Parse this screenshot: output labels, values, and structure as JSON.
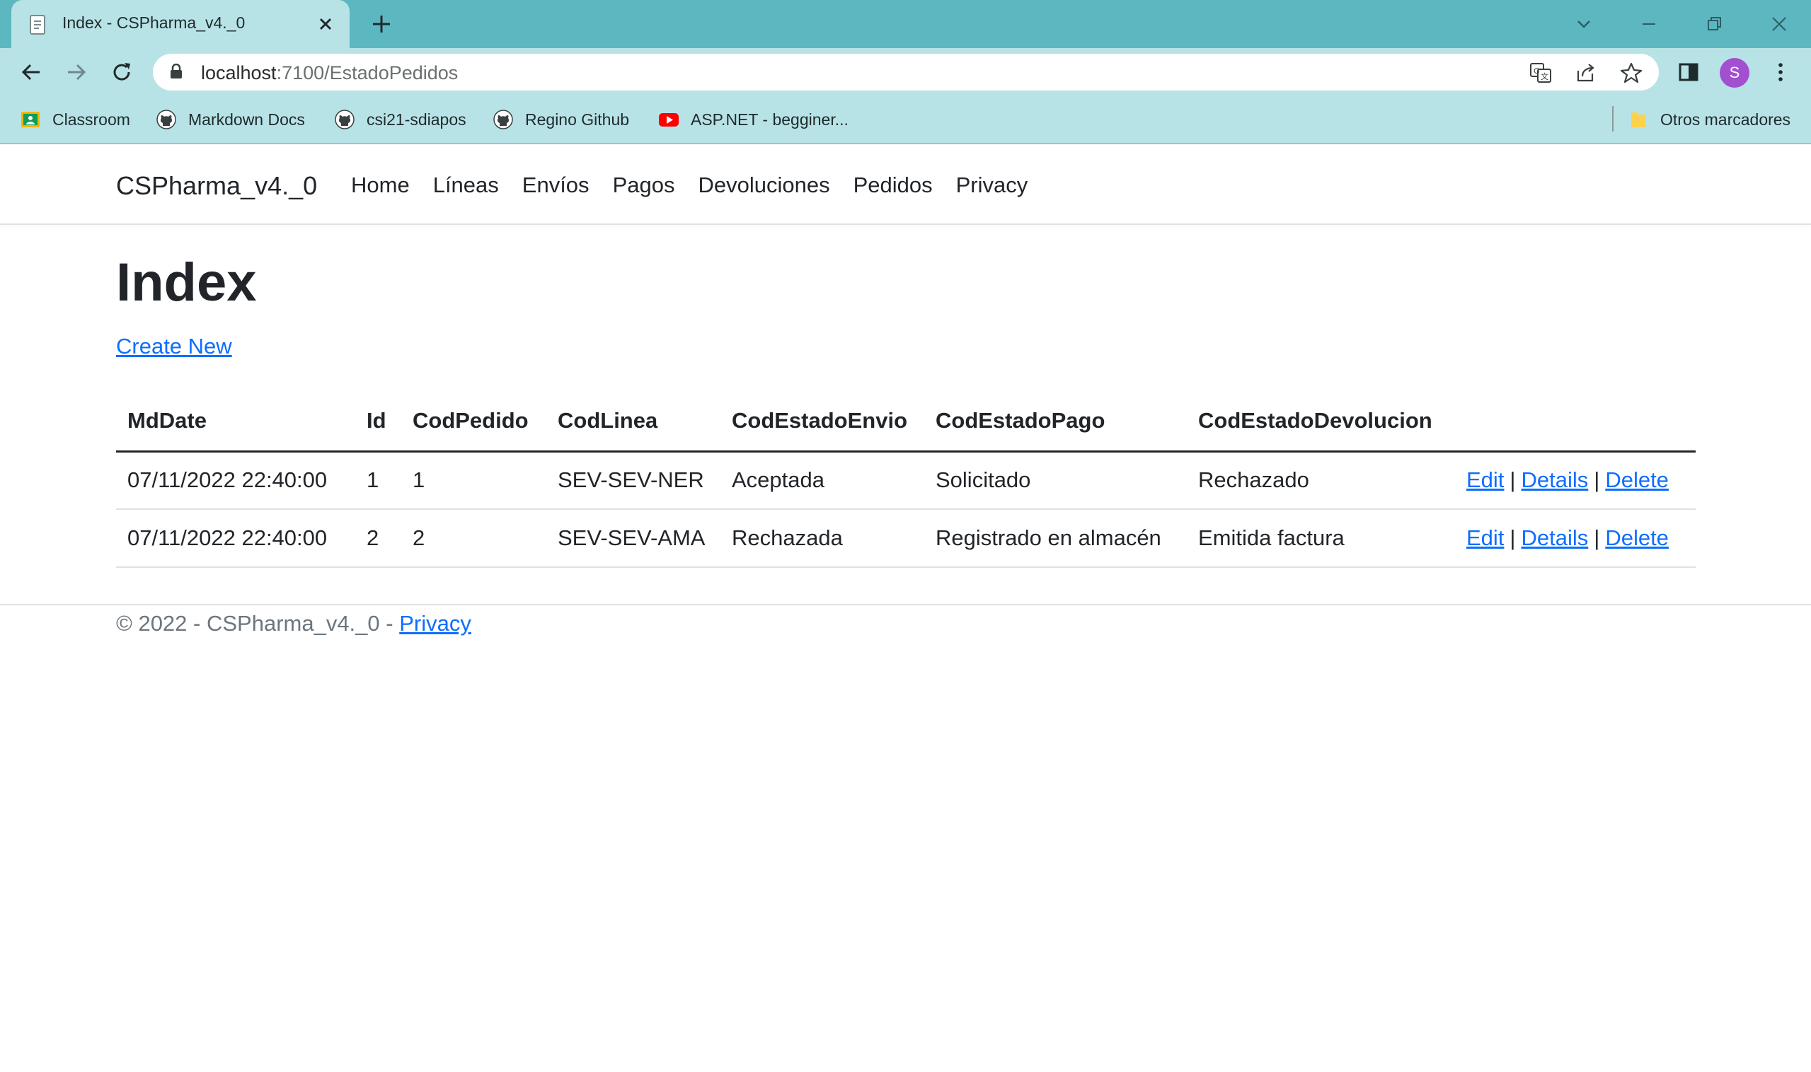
{
  "browser": {
    "tab_title": "Index - CSPharma_v4._0",
    "url_host": "localhost",
    "url_path": ":7100/EstadoPedidos",
    "avatar_letter": "S",
    "accent_color": "#5cb7c1",
    "bookmarks": [
      {
        "label": "Classroom",
        "icon": "classroom-icon"
      },
      {
        "label": "Markdown Docs",
        "icon": "github-icon"
      },
      {
        "label": "csi21-sdiapos",
        "icon": "github-icon"
      },
      {
        "label": "Regino Github",
        "icon": "github-icon"
      },
      {
        "label": "ASP.NET - begginer...",
        "icon": "youtube-icon"
      }
    ],
    "other_bookmarks": "Otros marcadores"
  },
  "navbar": {
    "brand": "CSPharma_v4._0",
    "links": [
      "Home",
      "Líneas",
      "Envíos",
      "Pagos",
      "Devoluciones",
      "Pedidos",
      "Privacy"
    ]
  },
  "main": {
    "title": "Index",
    "create_new": "Create New",
    "columns": [
      "MdDate",
      "Id",
      "CodPedido",
      "CodLinea",
      "CodEstadoEnvio",
      "CodEstadoPago",
      "CodEstadoDevolucion"
    ],
    "rows": [
      {
        "MdDate": "07/11/2022 22:40:00",
        "Id": "1",
        "CodPedido": "1",
        "CodLinea": "SEV-SEV-NER",
        "CodEstadoEnvio": "Aceptada",
        "CodEstadoPago": "Solicitado",
        "CodEstadoDevolucion": "Rechazado"
      },
      {
        "MdDate": "07/11/2022 22:40:00",
        "Id": "2",
        "CodPedido": "2",
        "CodLinea": "SEV-SEV-AMA",
        "CodEstadoEnvio": "Rechazada",
        "CodEstadoPago": "Registrado en almacén",
        "CodEstadoDevolucion": "Emitida factura"
      }
    ],
    "actions": {
      "edit": "Edit",
      "details": "Details",
      "delete": "Delete",
      "separator": "|"
    }
  },
  "footer": {
    "text": "© 2022 - CSPharma_v4._0 - ",
    "privacy": "Privacy"
  },
  "colors": {
    "link": "#0d6efd",
    "text": "#212529",
    "muted": "#6c757d"
  }
}
